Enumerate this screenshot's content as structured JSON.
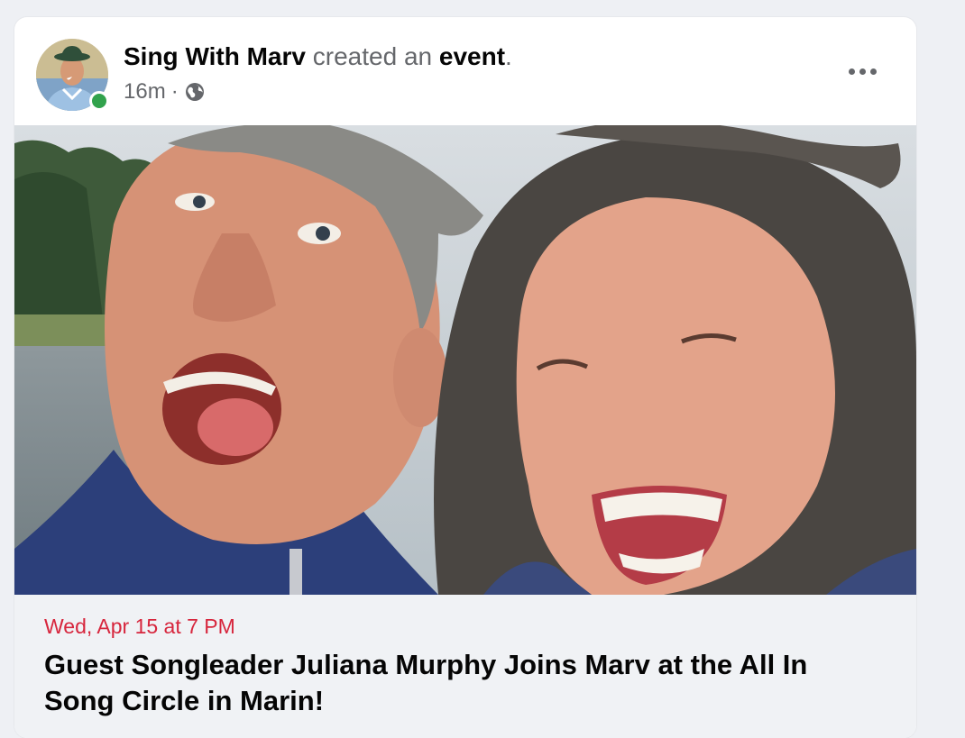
{
  "post": {
    "author": "Sing With Marv",
    "action": "created an",
    "object": "event",
    "punctuation": ".",
    "timestamp": "16m",
    "separator": "·",
    "privacy_icon": "globe-icon",
    "more_icon": "more-options-icon"
  },
  "event": {
    "date": "Wed, Apr 15 at 7 PM",
    "title": "Guest Songleader Juliana Murphy Joins Marv at the All In Song Circle in Marin!"
  },
  "colors": {
    "date_red": "#d7263d",
    "online_green": "#31a24c",
    "text_secondary": "#65676b"
  }
}
